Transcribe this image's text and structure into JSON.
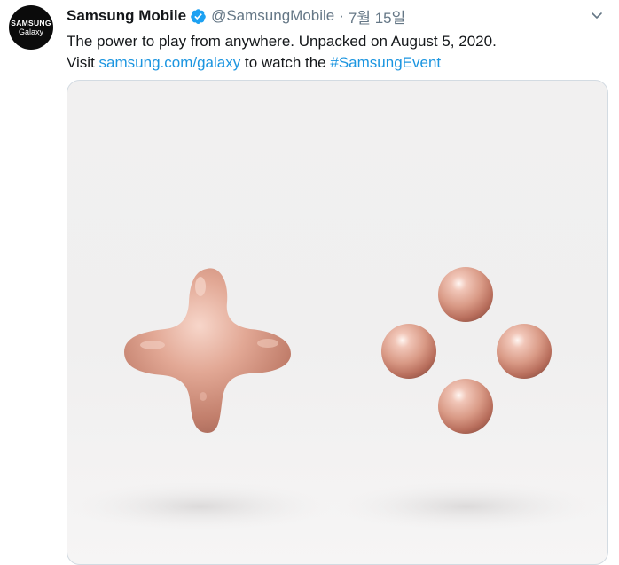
{
  "tweet": {
    "avatar": {
      "line1": "SAMSUNG",
      "line2": "Galaxy"
    },
    "author_name": "Samsung Mobile",
    "handle": "@SamsungMobile",
    "separator": "·",
    "date": "7월 15일",
    "text_line1": "The power to play from anywhere. Unpacked on August 5, 2020.",
    "text_visit": "Visit",
    "text_link": "samsung.com/galaxy",
    "text_mid": "to watch the",
    "text_hashtag": "#SamsungEvent"
  },
  "icons": {
    "verified": "verified-badge-icon",
    "menu": "chevron-down-icon"
  },
  "colors": {
    "link": "#1b95e0",
    "muted": "#657786",
    "verified": "#1da1f2",
    "rose_gold": "#e0a797"
  }
}
